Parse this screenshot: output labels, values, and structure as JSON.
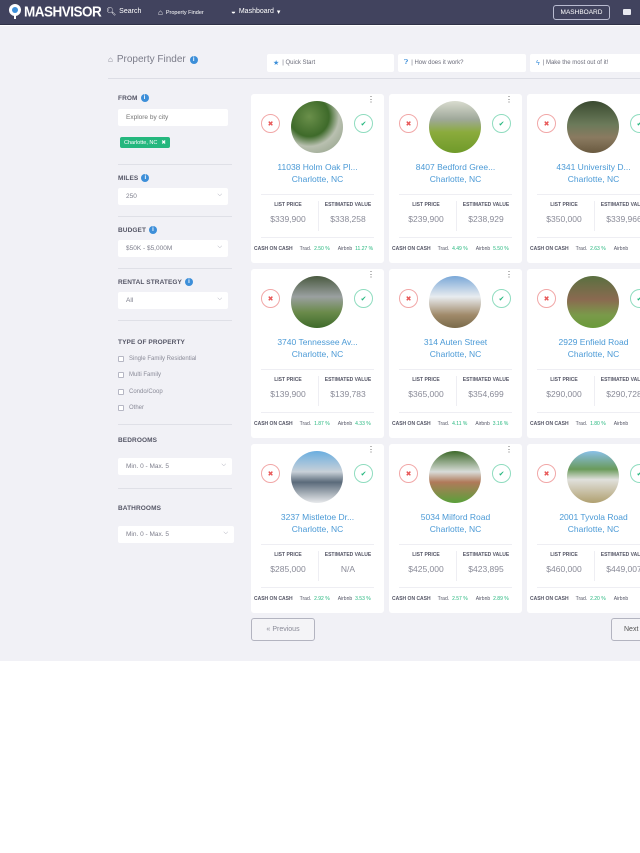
{
  "navbar": {
    "brand": "MASHVISOR",
    "items": [
      {
        "label": "Search",
        "icon": "search-icon"
      },
      {
        "label": "Property Finder",
        "icon": "property-finder-icon"
      },
      {
        "label": "Mashboard",
        "icon": "dashboard-icon",
        "caret": "▾"
      }
    ],
    "mashboard_button": "MASHBOARD",
    "messages_icon": "messages-icon"
  },
  "header": {
    "title": "Property Finder",
    "info": "i",
    "help_links": [
      {
        "label": "| Quick Start",
        "icon": "star-icon"
      },
      {
        "label": "| How does it work?",
        "icon": "question-icon"
      },
      {
        "label": "| Make the most out of it!",
        "icon": "bolt-icon"
      }
    ]
  },
  "filters": {
    "from": {
      "label": "FROM",
      "placeholder": "Explore by city",
      "tag": "Charlotte, NC"
    },
    "miles": {
      "label": "MILES",
      "value": "250"
    },
    "budget": {
      "label": "BUDGET",
      "value": "$50K - $5,000M"
    },
    "rental_strategy": {
      "label": "RENTAL STRATEGY",
      "value": "All"
    },
    "type_of_property": {
      "label": "TYPE OF PROPERTY",
      "options": [
        {
          "label": "Single Family Residential",
          "checked": false
        },
        {
          "label": "Multi Family",
          "checked": false
        },
        {
          "label": "Condo/Coop",
          "checked": false
        },
        {
          "label": "Other",
          "checked": false
        }
      ]
    },
    "bedrooms": {
      "label": "BEDROOMS",
      "value": "Min. 0 - Max. 5"
    },
    "bathrooms": {
      "label": "BATHROOMS",
      "value": "Min. 0 - Max. 5"
    }
  },
  "card_labels": {
    "list_price": "LIST PRICE",
    "estimated_value": "ESTIMATED VALUE",
    "cash_on_cash": "CASH ON CASH",
    "trad": "Trad.",
    "airbnb": "Airbnb"
  },
  "properties": [
    {
      "address": "11038 Holm Oak Pl...",
      "city": "Charlotte, NC",
      "list_price": "$339,900",
      "estimated_value": "$338,258",
      "trad": "2.50 %",
      "airbnb": "11.27 %"
    },
    {
      "address": "8407 Bedford Gree...",
      "city": "Charlotte, NC",
      "list_price": "$239,900",
      "estimated_value": "$238,929",
      "trad": "4.49 %",
      "airbnb": "5.50 %"
    },
    {
      "address": "4341 University D...",
      "city": "Charlotte, NC",
      "list_price": "$350,000",
      "estimated_value": "$339,966",
      "trad": "2.63 %",
      "airbnb": ""
    },
    {
      "address": "3740 Tennessee Av...",
      "city": "Charlotte, NC",
      "list_price": "$139,900",
      "estimated_value": "$139,783",
      "trad": "1.87 %",
      "airbnb": "4.33 %"
    },
    {
      "address": "314 Auten Street",
      "city": "Charlotte, NC",
      "list_price": "$365,000",
      "estimated_value": "$354,699",
      "trad": "4.11 %",
      "airbnb": "3.16 %"
    },
    {
      "address": "2929 Enfield Road",
      "city": "Charlotte, NC",
      "list_price": "$290,000",
      "estimated_value": "$290,728",
      "trad": "1.80 %",
      "airbnb": ""
    },
    {
      "address": "3237 Mistletoe Dr...",
      "city": "Charlotte, NC",
      "list_price": "$285,000",
      "estimated_value": "N/A",
      "trad": "2.92 %",
      "airbnb": "3.53 %"
    },
    {
      "address": "5034 Milford Road",
      "city": "Charlotte, NC",
      "list_price": "$425,000",
      "estimated_value": "$423,895",
      "trad": "2.57 %",
      "airbnb": "2.89 %"
    },
    {
      "address": "2001 Tyvola Road",
      "city": "Charlotte, NC",
      "list_price": "$460,000",
      "estimated_value": "$449,007",
      "trad": "2.20 %",
      "airbnb": ""
    }
  ],
  "pagination": {
    "previous": "Previous",
    "next": "Next"
  },
  "colors": {
    "navbar": "#41435e",
    "accent": "#3d8fd9",
    "link": "#4b9ad6",
    "positive": "#25b77e",
    "reject": "#e85858"
  }
}
